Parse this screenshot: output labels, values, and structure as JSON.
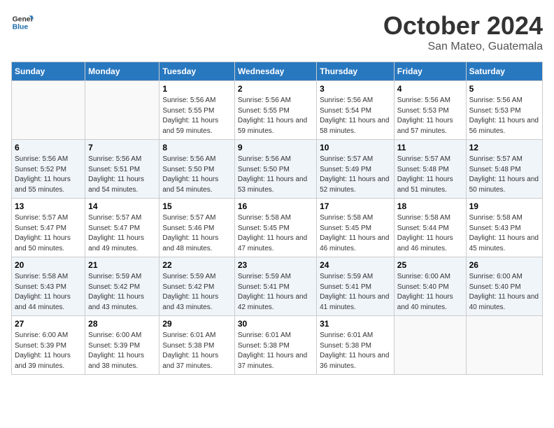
{
  "header": {
    "logo_line1": "General",
    "logo_line2": "Blue",
    "month": "October 2024",
    "location": "San Mateo, Guatemala"
  },
  "days_of_week": [
    "Sunday",
    "Monday",
    "Tuesday",
    "Wednesday",
    "Thursday",
    "Friday",
    "Saturday"
  ],
  "weeks": [
    [
      {
        "day": "",
        "sunrise": "",
        "sunset": "",
        "daylight": ""
      },
      {
        "day": "",
        "sunrise": "",
        "sunset": "",
        "daylight": ""
      },
      {
        "day": "1",
        "sunrise": "Sunrise: 5:56 AM",
        "sunset": "Sunset: 5:55 PM",
        "daylight": "Daylight: 11 hours and 59 minutes."
      },
      {
        "day": "2",
        "sunrise": "Sunrise: 5:56 AM",
        "sunset": "Sunset: 5:55 PM",
        "daylight": "Daylight: 11 hours and 59 minutes."
      },
      {
        "day": "3",
        "sunrise": "Sunrise: 5:56 AM",
        "sunset": "Sunset: 5:54 PM",
        "daylight": "Daylight: 11 hours and 58 minutes."
      },
      {
        "day": "4",
        "sunrise": "Sunrise: 5:56 AM",
        "sunset": "Sunset: 5:53 PM",
        "daylight": "Daylight: 11 hours and 57 minutes."
      },
      {
        "day": "5",
        "sunrise": "Sunrise: 5:56 AM",
        "sunset": "Sunset: 5:53 PM",
        "daylight": "Daylight: 11 hours and 56 minutes."
      }
    ],
    [
      {
        "day": "6",
        "sunrise": "Sunrise: 5:56 AM",
        "sunset": "Sunset: 5:52 PM",
        "daylight": "Daylight: 11 hours and 55 minutes."
      },
      {
        "day": "7",
        "sunrise": "Sunrise: 5:56 AM",
        "sunset": "Sunset: 5:51 PM",
        "daylight": "Daylight: 11 hours and 54 minutes."
      },
      {
        "day": "8",
        "sunrise": "Sunrise: 5:56 AM",
        "sunset": "Sunset: 5:50 PM",
        "daylight": "Daylight: 11 hours and 54 minutes."
      },
      {
        "day": "9",
        "sunrise": "Sunrise: 5:56 AM",
        "sunset": "Sunset: 5:50 PM",
        "daylight": "Daylight: 11 hours and 53 minutes."
      },
      {
        "day": "10",
        "sunrise": "Sunrise: 5:57 AM",
        "sunset": "Sunset: 5:49 PM",
        "daylight": "Daylight: 11 hours and 52 minutes."
      },
      {
        "day": "11",
        "sunrise": "Sunrise: 5:57 AM",
        "sunset": "Sunset: 5:48 PM",
        "daylight": "Daylight: 11 hours and 51 minutes."
      },
      {
        "day": "12",
        "sunrise": "Sunrise: 5:57 AM",
        "sunset": "Sunset: 5:48 PM",
        "daylight": "Daylight: 11 hours and 50 minutes."
      }
    ],
    [
      {
        "day": "13",
        "sunrise": "Sunrise: 5:57 AM",
        "sunset": "Sunset: 5:47 PM",
        "daylight": "Daylight: 11 hours and 50 minutes."
      },
      {
        "day": "14",
        "sunrise": "Sunrise: 5:57 AM",
        "sunset": "Sunset: 5:47 PM",
        "daylight": "Daylight: 11 hours and 49 minutes."
      },
      {
        "day": "15",
        "sunrise": "Sunrise: 5:57 AM",
        "sunset": "Sunset: 5:46 PM",
        "daylight": "Daylight: 11 hours and 48 minutes."
      },
      {
        "day": "16",
        "sunrise": "Sunrise: 5:58 AM",
        "sunset": "Sunset: 5:45 PM",
        "daylight": "Daylight: 11 hours and 47 minutes."
      },
      {
        "day": "17",
        "sunrise": "Sunrise: 5:58 AM",
        "sunset": "Sunset: 5:45 PM",
        "daylight": "Daylight: 11 hours and 46 minutes."
      },
      {
        "day": "18",
        "sunrise": "Sunrise: 5:58 AM",
        "sunset": "Sunset: 5:44 PM",
        "daylight": "Daylight: 11 hours and 46 minutes."
      },
      {
        "day": "19",
        "sunrise": "Sunrise: 5:58 AM",
        "sunset": "Sunset: 5:43 PM",
        "daylight": "Daylight: 11 hours and 45 minutes."
      }
    ],
    [
      {
        "day": "20",
        "sunrise": "Sunrise: 5:58 AM",
        "sunset": "Sunset: 5:43 PM",
        "daylight": "Daylight: 11 hours and 44 minutes."
      },
      {
        "day": "21",
        "sunrise": "Sunrise: 5:59 AM",
        "sunset": "Sunset: 5:42 PM",
        "daylight": "Daylight: 11 hours and 43 minutes."
      },
      {
        "day": "22",
        "sunrise": "Sunrise: 5:59 AM",
        "sunset": "Sunset: 5:42 PM",
        "daylight": "Daylight: 11 hours and 43 minutes."
      },
      {
        "day": "23",
        "sunrise": "Sunrise: 5:59 AM",
        "sunset": "Sunset: 5:41 PM",
        "daylight": "Daylight: 11 hours and 42 minutes."
      },
      {
        "day": "24",
        "sunrise": "Sunrise: 5:59 AM",
        "sunset": "Sunset: 5:41 PM",
        "daylight": "Daylight: 11 hours and 41 minutes."
      },
      {
        "day": "25",
        "sunrise": "Sunrise: 6:00 AM",
        "sunset": "Sunset: 5:40 PM",
        "daylight": "Daylight: 11 hours and 40 minutes."
      },
      {
        "day": "26",
        "sunrise": "Sunrise: 6:00 AM",
        "sunset": "Sunset: 5:40 PM",
        "daylight": "Daylight: 11 hours and 40 minutes."
      }
    ],
    [
      {
        "day": "27",
        "sunrise": "Sunrise: 6:00 AM",
        "sunset": "Sunset: 5:39 PM",
        "daylight": "Daylight: 11 hours and 39 minutes."
      },
      {
        "day": "28",
        "sunrise": "Sunrise: 6:00 AM",
        "sunset": "Sunset: 5:39 PM",
        "daylight": "Daylight: 11 hours and 38 minutes."
      },
      {
        "day": "29",
        "sunrise": "Sunrise: 6:01 AM",
        "sunset": "Sunset: 5:38 PM",
        "daylight": "Daylight: 11 hours and 37 minutes."
      },
      {
        "day": "30",
        "sunrise": "Sunrise: 6:01 AM",
        "sunset": "Sunset: 5:38 PM",
        "daylight": "Daylight: 11 hours and 37 minutes."
      },
      {
        "day": "31",
        "sunrise": "Sunrise: 6:01 AM",
        "sunset": "Sunset: 5:38 PM",
        "daylight": "Daylight: 11 hours and 36 minutes."
      },
      {
        "day": "",
        "sunrise": "",
        "sunset": "",
        "daylight": ""
      },
      {
        "day": "",
        "sunrise": "",
        "sunset": "",
        "daylight": ""
      }
    ]
  ]
}
